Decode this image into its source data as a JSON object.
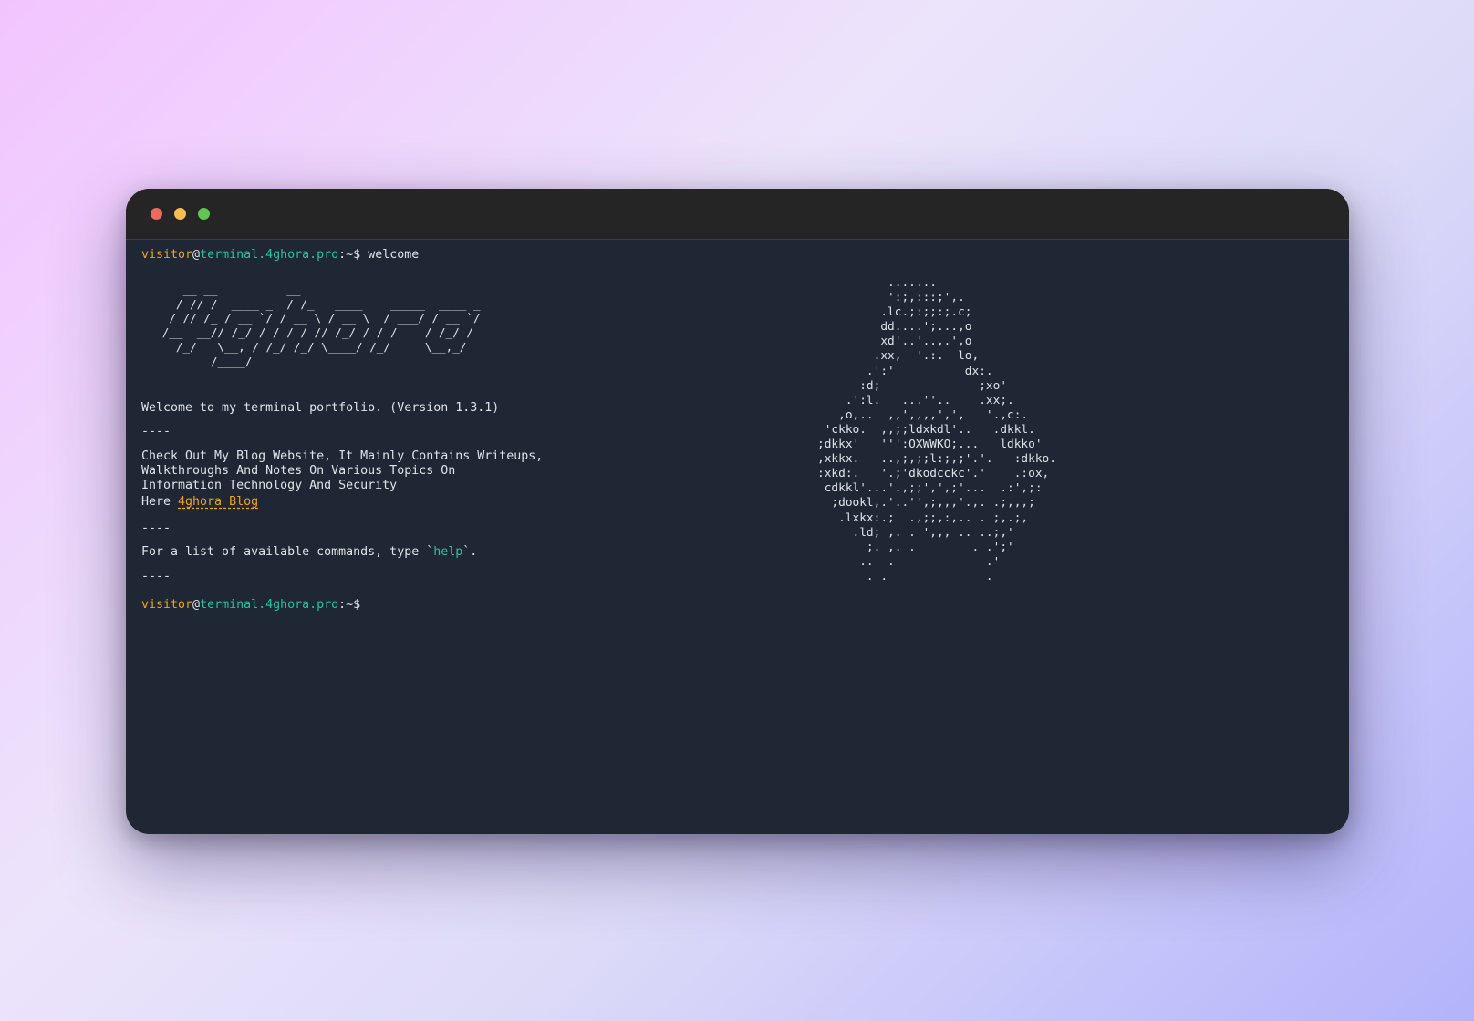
{
  "window": {
    "controls": [
      "close",
      "minimize",
      "maximize"
    ],
    "colors": {
      "close": "#ed6a5e",
      "minimize": "#f5bf4f",
      "maximize": "#61c554",
      "background": "#1e2733",
      "titlebar": "#252525"
    }
  },
  "prompt": {
    "user": "visitor",
    "at": "@",
    "host": "terminal.4ghora.pro",
    "path": ":~$",
    "colors": {
      "user": "#f4a21b",
      "host": "#23c4a0"
    }
  },
  "history": {
    "command": "welcome"
  },
  "banner_art": "      __ __          __\n     / // /  ____ _  / /_   ____    _____  ____ _\n    / // /_ / __ `/ / __ \\ / __ \\  / ___/ / __ `/\n   /__  __// /_/ / / / / // /_/ / / /    / /_/ /\n     /_/   \\__, / /_/ /_/ \\____/ /_/     \\__,_/\n          /____/",
  "logo_art": "          .......\n          ':;,:::;',.\n         .lc.;:;;:;.c;\n         dd....';...,o\n         xd'..'..,.',o\n        .xx,  '.:.  lo,\n       .':'          dx:.\n      :d;              ;xo'\n    .':l.   ...''..    .xx;.\n   ,o,..  ,,',,,,',',   '.,c:.\n 'ckko.  ,,;;ldxkdl'..   .dkkl.\n;dkkx'   ''':OXWWKO;...   ldkko'\n,xkkx.   ..,;,;;l:;,;'.'.   :dkko.\n:xkd:.   '.;'dkodcckc'.'    .:ox,\n cdkkl'...'.,;;',',;'...  .:',;:\n  ;dookl,.'..'',;,,,'.,. .;,,,;\n   .lxkx:.;  .,;;,:,.. . ;,.;,\n     .ld; ,. . ',,, .. ..;,'\n       ;. ,. .        . .';'\n      ..  .             .'\n       . .              .",
  "welcome": {
    "version_line": "Welcome to my terminal portfolio. (Version 1.3.1)",
    "separator": "----",
    "blog_text_1": "Check Out My Blog Website, It Mainly Contains Writeups,",
    "blog_text_2": "Walkthroughs And Notes On Various Topics On",
    "blog_text_3": "Information Technology And Security",
    "blog_here": "Here ",
    "blog_link": "4ghora Blog",
    "help_prefix": "For a list of available commands, type `",
    "help_command": "help",
    "help_suffix": "`."
  }
}
